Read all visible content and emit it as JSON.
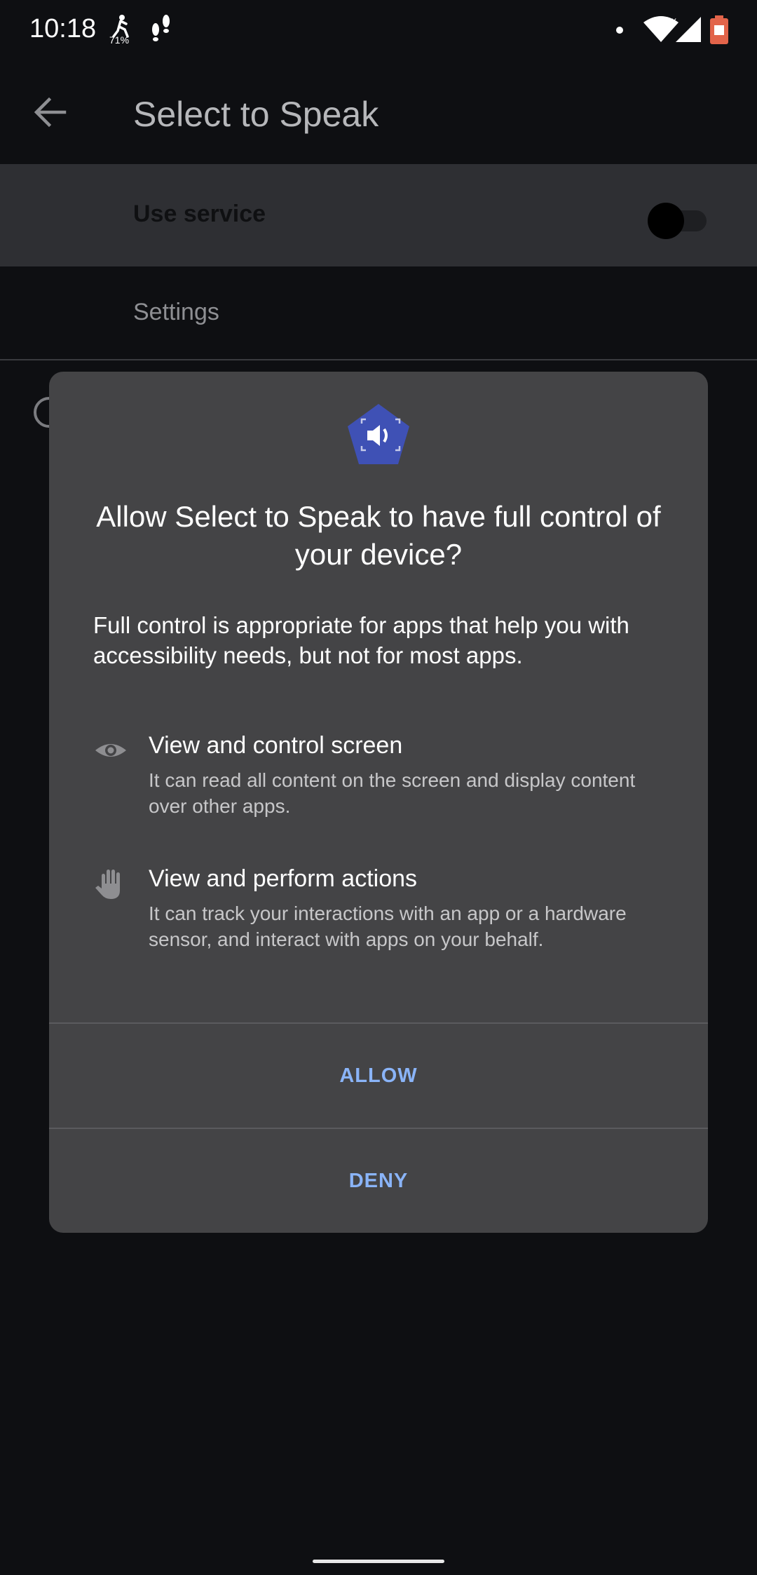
{
  "status_bar": {
    "time": "10:18",
    "icons": [
      "hiking-icon",
      "footprints-icon",
      "notification-dot-icon",
      "wifi-icon",
      "signal-icon",
      "battery-icon"
    ],
    "battery_color": "#e2644a"
  },
  "app_bar": {
    "back_icon": "arrow-back-icon",
    "title": "Select to Speak"
  },
  "settings": {
    "use_service_label": "Use service",
    "use_service_enabled": false,
    "settings_label": "Settings"
  },
  "dialog": {
    "icon": "select-to-speak-icon",
    "icon_color": "#3f51b5",
    "title": "Allow Select to Speak to have full control of your device?",
    "description": "Full control is appropriate for apps that help you with accessibility needs, but not for most apps.",
    "permissions": [
      {
        "icon": "eye-icon",
        "title": "View and control screen",
        "description": "It can read all content on the screen and display content over other apps."
      },
      {
        "icon": "hand-icon",
        "title": "View and perform actions",
        "description": "It can track your interactions with an app or a hardware sensor, and interact with apps on your behalf."
      }
    ],
    "allow_label": "ALLOW",
    "deny_label": "DENY",
    "button_color": "#8ab4f8"
  }
}
